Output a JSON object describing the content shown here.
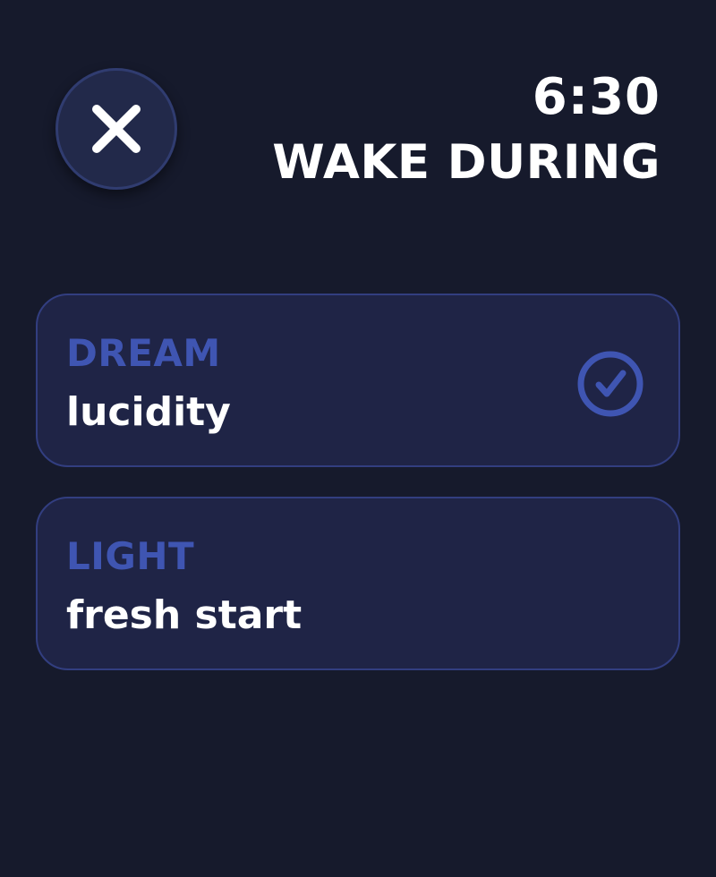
{
  "header": {
    "time": "6:30",
    "title": "WAKE DURING"
  },
  "options": [
    {
      "label": "DREAM",
      "sub": "lucidity",
      "selected": true
    },
    {
      "label": "LIGHT",
      "sub": "fresh start",
      "selected": false
    }
  ],
  "icons": {
    "close": "close-icon",
    "check": "checkmark-circle-icon"
  },
  "colors": {
    "background": "#161a2c",
    "card": "#1f2446",
    "card_border": "#323e80",
    "accent": "#3f55b2",
    "text": "#ffffff"
  }
}
